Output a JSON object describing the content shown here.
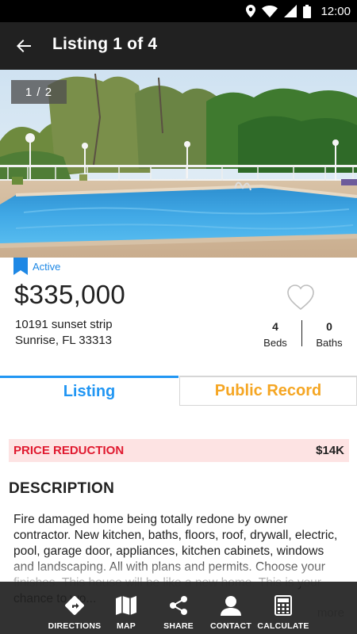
{
  "status_bar": {
    "time": "12:00"
  },
  "header": {
    "title": "Listing 1 of 4"
  },
  "photo": {
    "counter": "1 / 2"
  },
  "listing": {
    "status": "Active",
    "price": "$335,000",
    "address_line1": "10191 sunset strip",
    "address_line2": "Sunrise, FL 33313",
    "beds_value": "4",
    "beds_label": "Beds",
    "baths_value": "0",
    "baths_label": "Baths"
  },
  "tabs": [
    {
      "label": "Listing",
      "active": true
    },
    {
      "label": "Public Record",
      "active": false
    }
  ],
  "price_reduction": {
    "label": "PRICE REDUCTION",
    "amount": "$14K"
  },
  "description": {
    "heading": "DESCRIPTION",
    "text": "Fire damaged home being totally redone by owner contractor. New kitchen, baths, floors, roof, drywall, electric, pool, garage door, appliances, kitchen cabinets, windows and landscaping. All with plans and permits. Choose your finishes. This house will be like a new home. This is your chance to wo...",
    "more_label": "more"
  },
  "actions": [
    {
      "label": "DIRECTIONS",
      "icon": "directions-icon"
    },
    {
      "label": "MAP",
      "icon": "map-icon"
    },
    {
      "label": "SHARE",
      "icon": "share-icon"
    },
    {
      "label": "CONTACT",
      "icon": "contact-icon"
    },
    {
      "label": "CALCULATE",
      "icon": "calculator-icon"
    }
  ],
  "colors": {
    "accent_blue": "#2196f3",
    "public_record_orange": "#f5a623",
    "reduction_red": "#e0192f",
    "reduction_bg": "#fde3e3",
    "app_bar": "#212121"
  }
}
